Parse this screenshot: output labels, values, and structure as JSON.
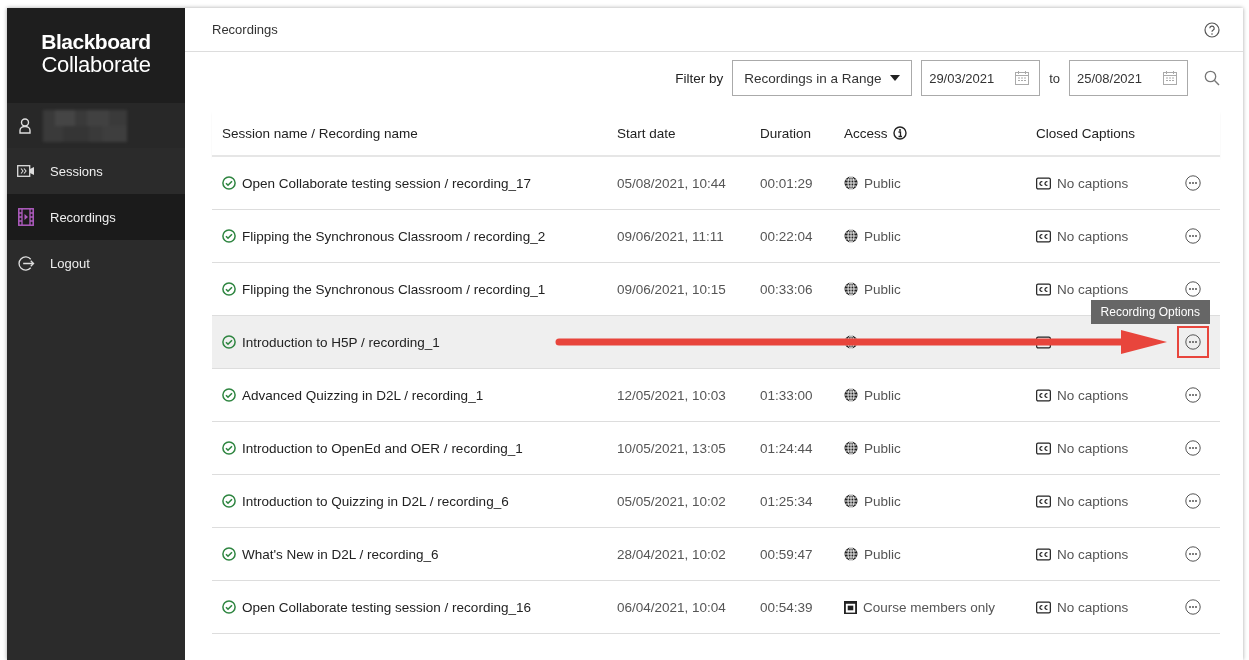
{
  "logo": {
    "line1": "Blackboard",
    "line2": "Collaborate"
  },
  "sidebar": {
    "items": [
      {
        "label": "Sessions",
        "kind": "sessions",
        "selected": false
      },
      {
        "label": "Recordings",
        "kind": "recordings",
        "selected": true
      },
      {
        "label": "Logout",
        "kind": "logout",
        "selected": false
      }
    ]
  },
  "header": {
    "title": "Recordings"
  },
  "filter": {
    "label": "Filter by",
    "select": "Recordings in a Range",
    "from": "29/03/2021",
    "separator": "to",
    "to": "25/08/2021"
  },
  "table": {
    "columns": [
      "Session name / Recording name",
      "Start date",
      "Duration",
      "Access",
      "Closed Captions"
    ],
    "rows": [
      {
        "name": "Open Collaborate testing session / recording_17",
        "start": "05/08/2021, 10:44",
        "duration": "00:01:29",
        "access": {
          "kind": "public",
          "label": "Public"
        },
        "captions": "No captions",
        "highlighted": false,
        "marked": false
      },
      {
        "name": "Flipping the Synchronous Classroom / recording_2",
        "start": "09/06/2021, 11:11",
        "duration": "00:22:04",
        "access": {
          "kind": "public",
          "label": "Public"
        },
        "captions": "No captions",
        "highlighted": false,
        "marked": false
      },
      {
        "name": "Flipping the Synchronous Classroom / recording_1",
        "start": "09/06/2021, 10:15",
        "duration": "00:33:06",
        "access": {
          "kind": "public",
          "label": "Public"
        },
        "captions": "No captions",
        "highlighted": false,
        "marked": false
      },
      {
        "name": "Introduction to H5P / recording_1",
        "access": {
          "kind": "public"
        },
        "highlighted": true,
        "marked": true,
        "tooltip": "Recording Options"
      },
      {
        "name": "Advanced Quizzing in D2L / recording_1",
        "start": "12/05/2021, 10:03",
        "duration": "01:33:00",
        "access": {
          "kind": "public",
          "label": "Public"
        },
        "captions": "No captions",
        "highlighted": false,
        "marked": false
      },
      {
        "name": "Introduction to OpenEd and OER / recording_1",
        "start": "10/05/2021, 13:05",
        "duration": "01:24:44",
        "access": {
          "kind": "public",
          "label": "Public"
        },
        "captions": "No captions",
        "highlighted": false,
        "marked": false
      },
      {
        "name": "Introduction to Quizzing in D2L / recording_6",
        "start": "05/05/2021, 10:02",
        "duration": "01:25:34",
        "access": {
          "kind": "public",
          "label": "Public"
        },
        "captions": "No captions",
        "highlighted": false,
        "marked": false
      },
      {
        "name": "What's New in D2L / recording_6",
        "start": "28/04/2021, 10:02",
        "duration": "00:59:47",
        "access": {
          "kind": "public",
          "label": "Public"
        },
        "captions": "No captions",
        "highlighted": false,
        "marked": false
      },
      {
        "name": "Open Collaborate testing session / recording_16",
        "start": "06/04/2021, 10:04",
        "duration": "00:54:39",
        "access": {
          "kind": "course",
          "label": "Course members only"
        },
        "captions": "No captions",
        "highlighted": false,
        "marked": false
      }
    ]
  }
}
